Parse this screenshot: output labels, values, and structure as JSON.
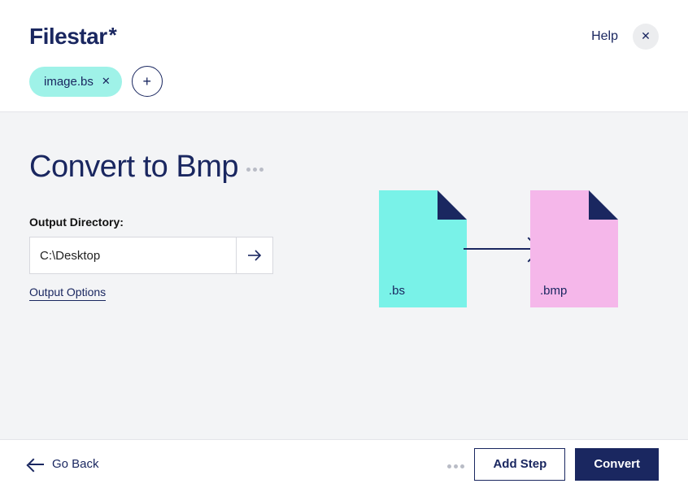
{
  "brand": {
    "name": "Filestar",
    "star": "*"
  },
  "header": {
    "help_label": "Help",
    "file_chip_label": "image.bs"
  },
  "main": {
    "title": "Convert to Bmp",
    "output_dir_label": "Output Directory:",
    "output_dir_value": "C:\\Desktop",
    "output_options_label": "Output Options"
  },
  "illustration": {
    "src_ext": ".bs",
    "dst_ext": ".bmp"
  },
  "footer": {
    "go_back_label": "Go Back",
    "add_step_label": "Add Step",
    "convert_label": "Convert"
  },
  "colors": {
    "primary": "#1a2760",
    "chip_bg": "#9ff2e8",
    "doc_src": "#79f2e8",
    "doc_dst": "#f5b7ea",
    "surface": "#f3f4f6"
  }
}
